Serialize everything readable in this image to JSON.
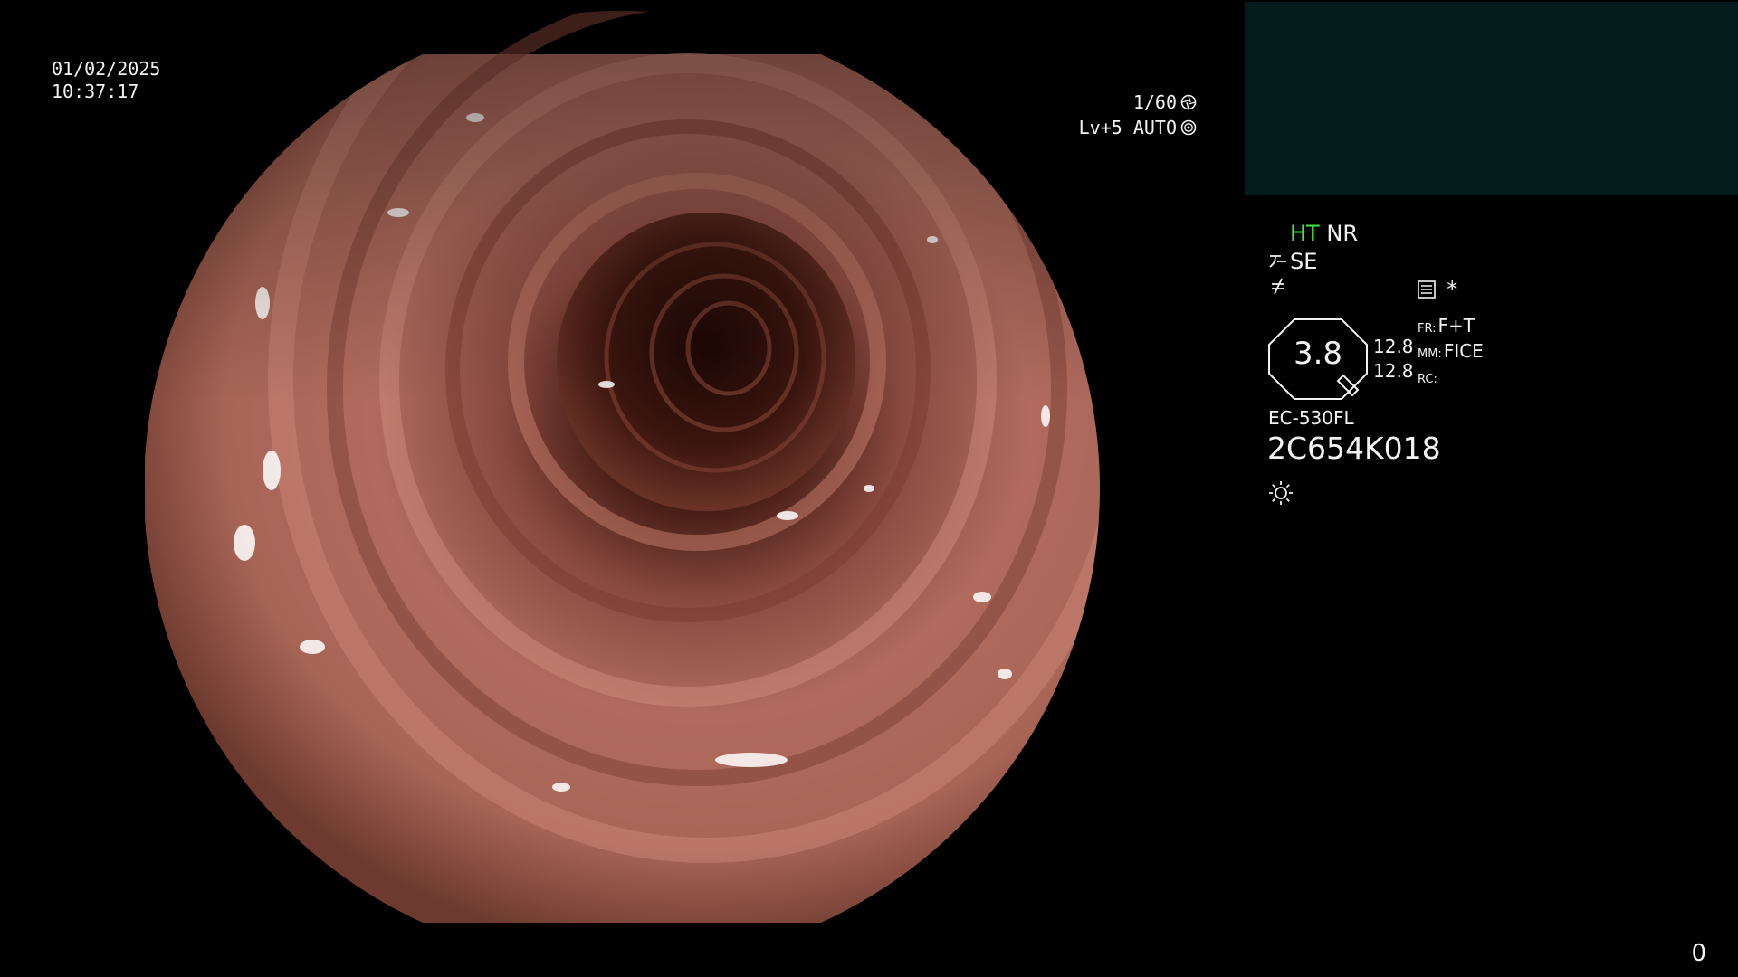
{
  "datetime": {
    "date": "01/02/2025",
    "time": "10:37:17"
  },
  "exposure": {
    "shutter": "1/60",
    "shutter_icon": "aperture-icon",
    "level": "Lv+5 AUTO",
    "level_icon": "auto-exposure-icon"
  },
  "scope_view": {
    "content": "endoscopic-image-icon"
  },
  "panel": {
    "ht": "HT",
    "nr": "NR",
    "se": "SE",
    "se_icon": "curve-enhance-icon",
    "f_icon": "not-equal-icon",
    "memo_icon": "memo-icon",
    "star": "*",
    "iris_value": "3.8",
    "side_values": [
      "12.8",
      "12.8"
    ],
    "modes": [
      {
        "key": "FR:",
        "value": "F+T"
      },
      {
        "key": "MM:",
        "value": "FICE"
      },
      {
        "key": "RC:",
        "value": ""
      }
    ],
    "model": "EC-530FL",
    "serial": "2C654K018",
    "light_icon": "sun-icon"
  },
  "counter": "0",
  "colors": {
    "background": "#000000",
    "thumb_box": "#031b1b",
    "ht_green": "#3fe83f",
    "text": "#f2f2f2"
  }
}
